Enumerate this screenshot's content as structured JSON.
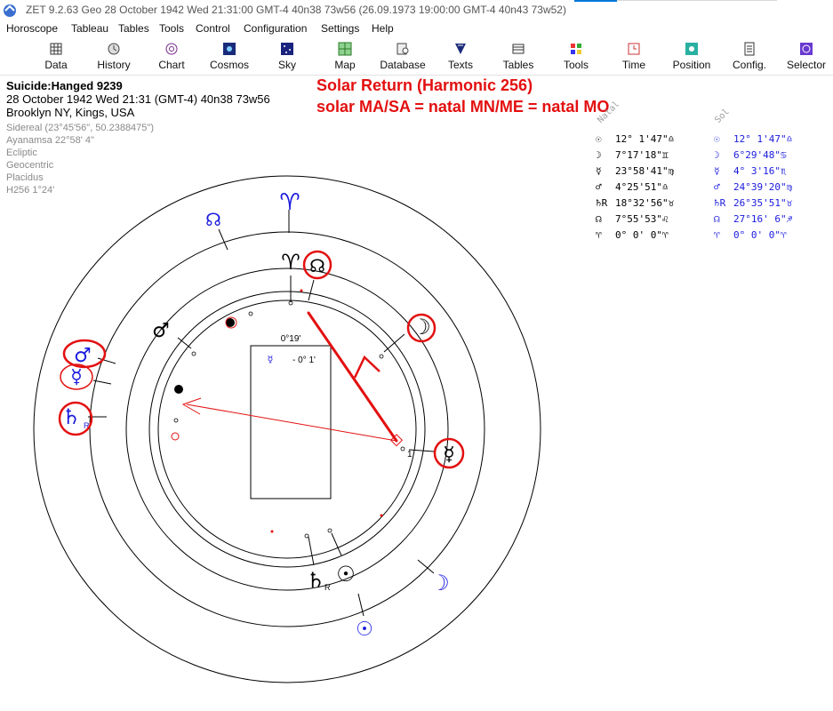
{
  "titlebar": {
    "title": "ZET 9.2.63 Geo   28 October 1942  Wed  21:31:00 GMT-4 40n38  73w56  (26.09.1973  19:00:00 GMT-4 40n43 73w52)"
  },
  "menu": [
    "Horoscope",
    "Tableau",
    "Tables",
    "Tools",
    "Control",
    "Configuration",
    "Settings",
    "Help"
  ],
  "toolbar": [
    {
      "label": "Data",
      "icon": "data-icon"
    },
    {
      "label": "History",
      "icon": "history-icon"
    },
    {
      "label": "Chart",
      "icon": "chart-icon"
    },
    {
      "label": "Cosmos",
      "icon": "cosmos-icon"
    },
    {
      "label": "Sky",
      "icon": "sky-icon"
    },
    {
      "label": "Map",
      "icon": "map-icon"
    },
    {
      "label": "Database",
      "icon": "database-icon"
    },
    {
      "label": "Texts",
      "icon": "texts-icon"
    },
    {
      "label": "Tables",
      "icon": "tables-icon"
    },
    {
      "label": "Tools",
      "icon": "tools-icon"
    },
    {
      "label": "Time",
      "icon": "time-icon"
    },
    {
      "label": "Position",
      "icon": "position-icon"
    },
    {
      "label": "Config.",
      "icon": "config-icon"
    },
    {
      "label": "Selector",
      "icon": "selector-icon"
    }
  ],
  "info": {
    "name": "Suicide:Hanged 9239",
    "line2": "28 October 1942  Wed  21:31 (GMT-4) 40n38  73w56",
    "line3": "Brooklyn NY, Kings, USA",
    "settings": [
      "Sidereal (23°45'56\", 50.2388475\")",
      "Ayanamsa 22°58' 4\"",
      "Ecliptic",
      "Geocentric",
      "Placidus",
      "H256   1°24'"
    ]
  },
  "annotation": {
    "line1": "Solar Return (Harmonic 256)",
    "line2": "solar MA/SA = natal MN/ME = natal MO",
    "color": "#e31010"
  },
  "wheel": {
    "center_box": {
      "orb_label": "0°19'",
      "aspect_glyph": "☿",
      "aspect_value": "- 0° 1'"
    },
    "cusp_label": "1",
    "natal_color": "#000000",
    "solar_color": "#1a1adf",
    "aspect_color": "#e31010"
  },
  "table": {
    "natal_header": "Natal",
    "solar_header": "Sol",
    "natal": [
      {
        "glyph": "☉",
        "value": "12° 1'47\"♎"
      },
      {
        "glyph": "☽",
        "value": "7°17'18\"♊"
      },
      {
        "glyph": "☿",
        "value": "23°58'41\"♍"
      },
      {
        "glyph": "♂",
        "value": "4°25'51\"♎"
      },
      {
        "glyph": "♄R",
        "value": "18°32'56\"♉"
      },
      {
        "glyph": "☊",
        "value": "7°55'53\"♌"
      },
      {
        "glyph": "♈",
        "value": "0° 0' 0\"♈"
      }
    ],
    "solar": [
      {
        "glyph": "☉",
        "value": "12° 1'47\"♎"
      },
      {
        "glyph": "☽",
        "value": "6°29'48\"♋"
      },
      {
        "glyph": "☿",
        "value": "4° 3'16\"♏"
      },
      {
        "glyph": "♂",
        "value": "24°39'20\"♍"
      },
      {
        "glyph": "♄R",
        "value": "26°35'51\"♉"
      },
      {
        "glyph": "☊",
        "value": "27°16' 6\"♐"
      },
      {
        "glyph": "♈",
        "value": "0° 0' 0\"♈"
      }
    ]
  }
}
